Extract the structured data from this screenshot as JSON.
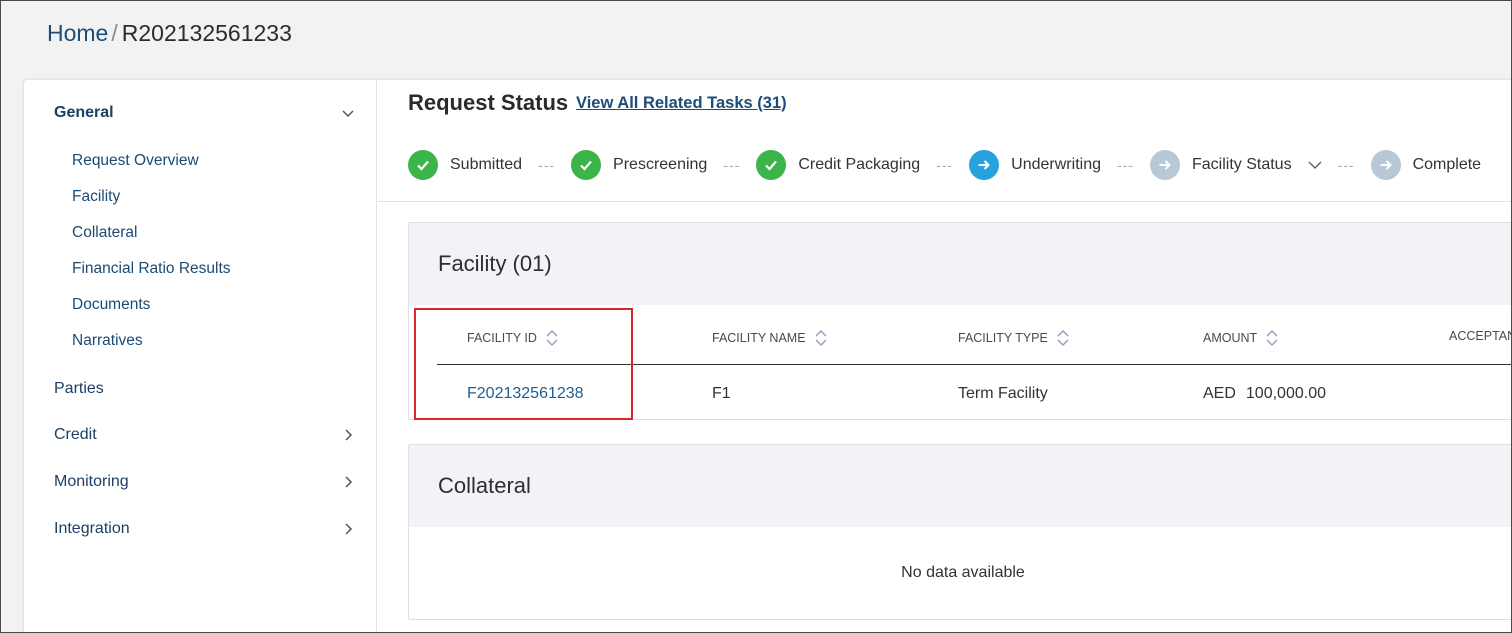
{
  "breadcrumb": {
    "home": "Home",
    "separator": "/",
    "current": "R202132561233"
  },
  "sidebar": {
    "general": {
      "label": "General",
      "icon": "chevron-down-icon",
      "items": [
        {
          "label": "Request Overview"
        },
        {
          "label": "Facility"
        },
        {
          "label": "Collateral"
        },
        {
          "label": "Financial Ratio Results"
        },
        {
          "label": "Documents"
        },
        {
          "label": "Narratives"
        }
      ]
    },
    "parties": {
      "label": "Parties"
    },
    "credit": {
      "label": "Credit",
      "icon": "chevron-right-icon"
    },
    "monitoring": {
      "label": "Monitoring",
      "icon": "chevron-right-icon"
    },
    "integration": {
      "label": "Integration",
      "icon": "chevron-right-icon"
    }
  },
  "request_status": {
    "title": "Request Status",
    "related_tasks_link": "View All Related Tasks (31)",
    "separator": "---",
    "steps": [
      {
        "label": "Submitted",
        "state": "done"
      },
      {
        "label": "Prescreening",
        "state": "done"
      },
      {
        "label": "Credit Packaging",
        "state": "done"
      },
      {
        "label": "Underwriting",
        "state": "current"
      },
      {
        "label": "Facility Status",
        "state": "pending",
        "has_dropdown": true
      },
      {
        "label": "Complete",
        "state": "pending"
      }
    ]
  },
  "facility_panel": {
    "title": "Facility (01)",
    "columns": [
      "FACILITY ID",
      "FACILITY NAME",
      "FACILITY TYPE",
      "AMOUNT",
      "ACCEPTAN"
    ],
    "rows": [
      {
        "facility_id": "F202132561238",
        "facility_name": "F1",
        "facility_type": "Term Facility",
        "currency": "AED",
        "amount": "100,000.00"
      }
    ]
  },
  "collateral_panel": {
    "title": "Collateral",
    "empty_text": "No data available"
  },
  "colors": {
    "done": "#3bb54a",
    "current": "#27a2de",
    "pending": "#b9c8d6",
    "link": "#1b4d7a",
    "highlight": "#d9262b"
  }
}
